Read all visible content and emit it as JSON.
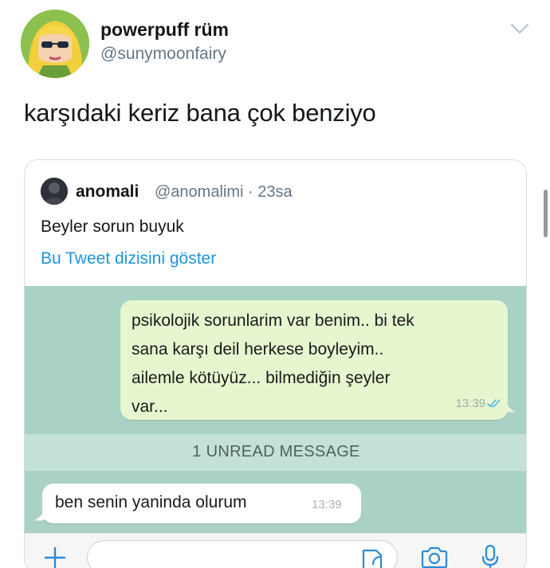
{
  "author": {
    "name": "powerpuff rüm",
    "handle": "@sunymoonfairy"
  },
  "tweet": {
    "text": "karşıdaki keriz bana çok benziyo"
  },
  "quoted": {
    "name": "anomali",
    "handle_time": "@anomalimi · 23sa",
    "text": "Beyler sorun buyuk",
    "thread_link": "Bu Tweet dizisini göster"
  },
  "chat": {
    "outgoing": {
      "lines": [
        "psikolojik sorunlarim var benim.. bi tek",
        "sana karşı deil herkese boyleyim..",
        "ailemle kötüyüz... bilmediğin şeyler",
        "var..."
      ],
      "time": "13:39"
    },
    "unread_label": "1 UNREAD MESSAGE",
    "incoming": {
      "text": "ben senin yaninda olurum",
      "time": "13:39"
    }
  },
  "colors": {
    "chat_background": "#a9d2c5",
    "outgoing_bubble": "#e6f6cf",
    "link": "#1b95e0",
    "read_ticks": "#4fb6ec"
  },
  "icons": [
    "chevron-down-icon",
    "double-check-icon",
    "plus-icon",
    "sticker-icon",
    "camera-icon",
    "microphone-icon"
  ]
}
